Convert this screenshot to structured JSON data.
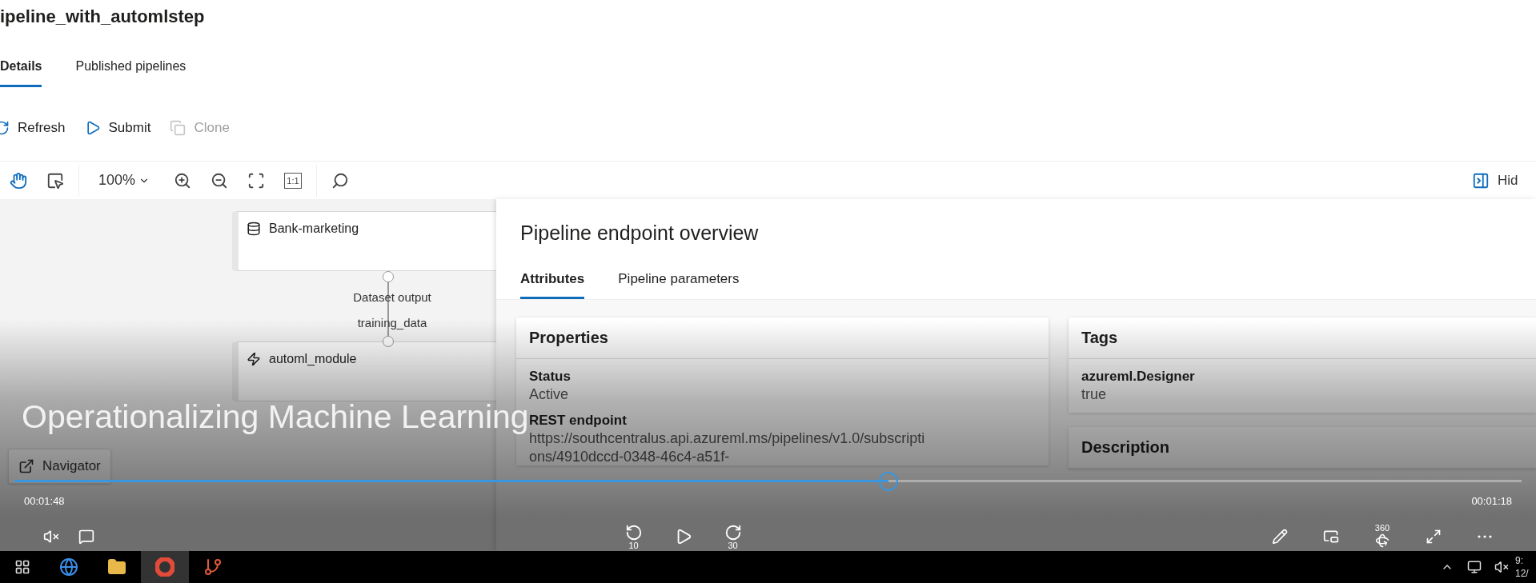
{
  "page": {
    "title": "ipeline_with_automlstep",
    "tabs": [
      {
        "label": "Details",
        "selected": true
      },
      {
        "label": "Published pipelines",
        "selected": false
      }
    ],
    "actions": [
      {
        "kind": "refresh",
        "label": "Refresh",
        "disabled": false
      },
      {
        "kind": "submit",
        "label": "Submit",
        "disabled": false
      },
      {
        "kind": "clone",
        "label": "Clone",
        "disabled": true
      }
    ],
    "tools": [
      {
        "kind": "pan",
        "selected": true
      },
      {
        "kind": "select",
        "selected": false
      }
    ],
    "zoom": "100%",
    "actual_size": "1:1",
    "hide": "Hid",
    "nodes": [
      {
        "kind": "dataset",
        "name": "Bank-marketing"
      },
      {
        "kind": "module",
        "name": "automl_module"
      }
    ],
    "edge": {
      "output": "Dataset output",
      "input": "training_data"
    },
    "navigator": "Navigator"
  },
  "panel": {
    "title": "Pipeline endpoint overview",
    "tabs": [
      {
        "label": "Attributes",
        "selected": true
      },
      {
        "label": "Pipeline parameters",
        "selected": false
      }
    ],
    "properties": {
      "title": "Properties",
      "fields": [
        {
          "label": "Status",
          "lines": [
            "Active"
          ]
        },
        {
          "label": "REST endpoint",
          "lines": [
            "https://southcentralus.api.azureml.ms/pipelines/v1.0/subscripti",
            "ons/4910dccd-0348-46c4-a51f-"
          ]
        }
      ]
    },
    "tags": {
      "title": "Tags",
      "items": [
        {
          "key": "azureml.Designer",
          "value": "true"
        }
      ]
    },
    "description": {
      "title": "Description"
    }
  },
  "video": {
    "title": "Operationalizing Machine Learning",
    "elapsed": "00:01:48",
    "remaining": "00:01:18",
    "level": 0.58,
    "muted": true,
    "rewind": "10",
    "forward": "30",
    "vr": "360"
  },
  "taskbar": {
    "apps": [
      {
        "kind": "browser",
        "selected": false
      },
      {
        "kind": "folder",
        "selected": false
      },
      {
        "kind": "chrome",
        "selected": true
      },
      {
        "kind": "git",
        "selected": false
      }
    ],
    "clock": [
      "9:",
      "12/"
    ]
  }
}
